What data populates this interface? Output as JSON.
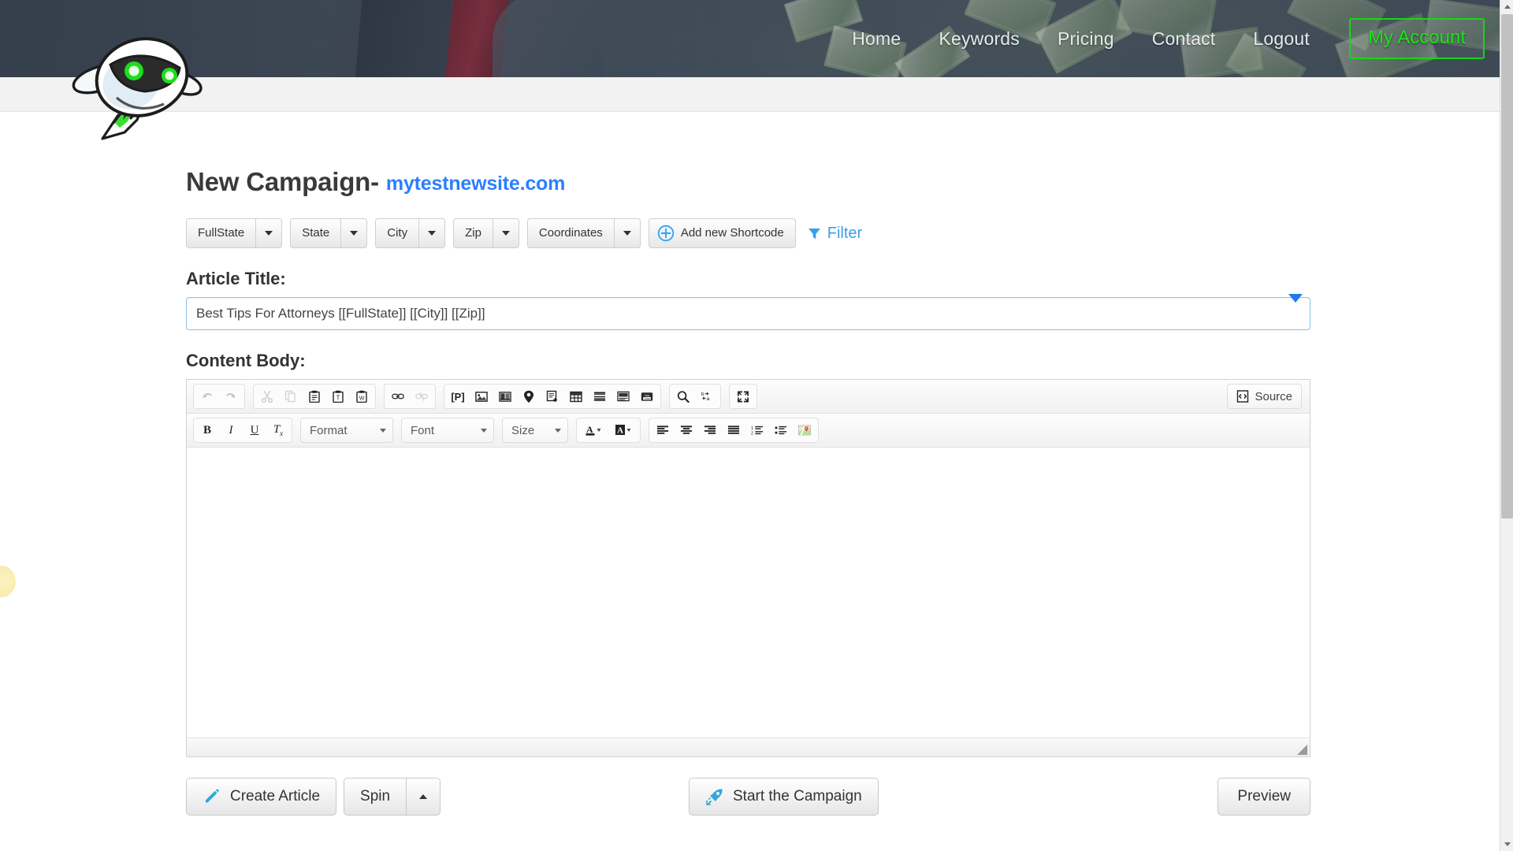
{
  "header": {
    "nav_items": [
      {
        "label": "Home",
        "name": "nav-home"
      },
      {
        "label": "Keywords",
        "name": "nav-keywords"
      },
      {
        "label": "Pricing",
        "name": "nav-pricing"
      },
      {
        "label": "Contact",
        "name": "nav-contact"
      },
      {
        "label": "Logout",
        "name": "nav-logout"
      }
    ],
    "my_account_label": "My Account",
    "my_account_color": "#1ae31a",
    "logo_icon": "rocket-robot-logo"
  },
  "page": {
    "title_prefix": "New Campaign",
    "title_dash": "-",
    "site_link": "mytestnewsite.com",
    "site_link_color": "#2a7fff"
  },
  "shortcodes": {
    "buttons": [
      {
        "label": "FullState",
        "name": "shortcode-fullstate"
      },
      {
        "label": "State",
        "name": "shortcode-state"
      },
      {
        "label": "City",
        "name": "shortcode-city"
      },
      {
        "label": "Zip",
        "name": "shortcode-zip"
      },
      {
        "label": "Coordinates",
        "name": "shortcode-coordinates"
      }
    ],
    "add_label": "Add new Shortcode",
    "add_icon": "plus-circle-icon",
    "filter_label": "Filter",
    "filter_icon": "funnel-icon",
    "filter_color": "#3aa0e8"
  },
  "article": {
    "title_label": "Article Title:",
    "title_value": "Best Tips For Attorneys [[FullState]] [[City]] [[Zip]]",
    "title_placeholder": "Article Title",
    "body_label": "Content Body:",
    "body_value": "",
    "body_placeholder": ""
  },
  "editor": {
    "source_label": "Source",
    "source_icon": "source-code-icon",
    "row1_groups": [
      {
        "name": "history-group",
        "buttons": [
          {
            "icon": "undo-icon",
            "glyph": "↶",
            "disabled": true,
            "name": "editor-undo"
          },
          {
            "icon": "redo-icon",
            "glyph": "↷",
            "disabled": true,
            "name": "editor-redo"
          }
        ]
      },
      {
        "name": "clipboard-group",
        "buttons": [
          {
            "icon": "cut-icon",
            "glyph": "✂",
            "disabled": true,
            "name": "editor-cut"
          },
          {
            "icon": "copy-icon",
            "glyph": "❐",
            "disabled": true,
            "name": "editor-copy"
          },
          {
            "icon": "paste-icon",
            "glyph": "Ὄb",
            "disabled": false,
            "name": "editor-paste"
          },
          {
            "icon": "paste-text-icon",
            "glyph": "T",
            "disabled": false,
            "name": "editor-paste-text"
          },
          {
            "icon": "paste-word-icon",
            "glyph": "W",
            "disabled": false,
            "name": "editor-paste-word"
          }
        ]
      },
      {
        "name": "link-group",
        "buttons": [
          {
            "icon": "link-icon",
            "glyph": "⚭",
            "disabled": false,
            "name": "editor-link"
          },
          {
            "icon": "unlink-icon",
            "glyph": "⚭",
            "disabled": true,
            "name": "editor-unlink"
          }
        ]
      },
      {
        "name": "insert-group",
        "buttons": [
          {
            "icon": "templates-icon",
            "glyph": "[P]",
            "disabled": false,
            "name": "editor-templates"
          },
          {
            "icon": "image-icon",
            "glyph": "Ὓc",
            "disabled": false,
            "name": "editor-image"
          },
          {
            "icon": "flash-icon",
            "glyph": "Ἲc",
            "disabled": false,
            "name": "editor-flash"
          },
          {
            "icon": "map-pin-icon",
            "glyph": "Ὄd",
            "disabled": false,
            "name": "editor-map-pin"
          },
          {
            "icon": "page-break-icon",
            "glyph": "὜b",
            "disabled": false,
            "name": "editor-page-break"
          },
          {
            "icon": "table-icon",
            "glyph": "▦",
            "disabled": false,
            "name": "editor-table"
          },
          {
            "icon": "horizontal-rule-icon",
            "glyph": "≡",
            "disabled": false,
            "name": "editor-horizontal-rule"
          },
          {
            "icon": "iframe-icon",
            "glyph": "▤",
            "disabled": false,
            "name": "editor-iframe"
          },
          {
            "icon": "youtube-icon",
            "glyph": "You",
            "disabled": false,
            "name": "editor-youtube"
          }
        ]
      },
      {
        "name": "find-group",
        "buttons": [
          {
            "icon": "search-icon",
            "glyph": "ὐd",
            "disabled": false,
            "name": "editor-find"
          },
          {
            "icon": "replace-icon",
            "glyph": "b→a",
            "disabled": false,
            "name": "editor-replace"
          }
        ]
      },
      {
        "name": "maximize-group",
        "buttons": [
          {
            "icon": "maximize-icon",
            "glyph": "⤡",
            "disabled": false,
            "name": "editor-maximize"
          }
        ]
      }
    ],
    "row2_groups": [
      {
        "name": "basic-styles-group",
        "buttons": [
          {
            "icon": "bold-icon",
            "glyph": "B",
            "name": "editor-bold"
          },
          {
            "icon": "italic-icon",
            "glyph": "I",
            "name": "editor-italic"
          },
          {
            "icon": "underline-icon",
            "glyph": "U",
            "name": "editor-underline"
          },
          {
            "icon": "remove-format-icon",
            "glyph": "Tx",
            "name": "editor-remove-format"
          }
        ]
      }
    ],
    "combos": [
      {
        "label": "Format",
        "name": "editor-format-combo"
      },
      {
        "label": "Font",
        "name": "editor-font-combo"
      },
      {
        "label": "Size",
        "name": "editor-size-combo"
      }
    ],
    "color_buttons": [
      {
        "icon": "text-color-icon",
        "glyph": "A",
        "name": "editor-text-color"
      },
      {
        "icon": "background-color-icon",
        "glyph": "A",
        "name": "editor-bg-color"
      }
    ],
    "paragraph_buttons": [
      {
        "icon": "align-left-icon",
        "name": "editor-align-left"
      },
      {
        "icon": "align-center-icon",
        "name": "editor-align-center"
      },
      {
        "icon": "align-right-icon",
        "name": "editor-align-right"
      },
      {
        "icon": "align-justify-icon",
        "name": "editor-align-justify"
      },
      {
        "icon": "numbered-list-icon",
        "name": "editor-numbered-list"
      },
      {
        "icon": "bulleted-list-icon",
        "name": "editor-bulleted-list"
      },
      {
        "icon": "google-maps-icon",
        "name": "editor-google-maps"
      }
    ]
  },
  "actions": {
    "create_article": {
      "label": "Create Article",
      "icon": "pencil-icon",
      "icon_color": "#2fa8e0"
    },
    "spin": {
      "label": "Spin",
      "icon": "caret-up-icon"
    },
    "start_campaign": {
      "label": "Start the Campaign",
      "icon": "rocket-icon",
      "icon_color": "#2fa8e0"
    },
    "preview": {
      "label": "Preview"
    }
  }
}
